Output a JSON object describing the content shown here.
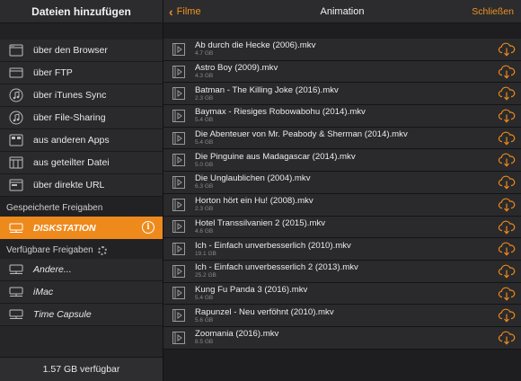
{
  "sidebar": {
    "header": "Dateien hinzufügen",
    "items": [
      {
        "label": "über den Browser",
        "icon": "browser-icon"
      },
      {
        "label": "über FTP",
        "icon": "ftp-icon"
      },
      {
        "label": "über iTunes Sync",
        "icon": "music-note-icon"
      },
      {
        "label": "über File-Sharing",
        "icon": "music-note-icon"
      },
      {
        "label": "aus anderen Apps",
        "icon": "apps-icon"
      },
      {
        "label": "aus geteilter Datei",
        "icon": "shared-file-icon"
      },
      {
        "label": "über direkte URL",
        "icon": "url-icon"
      }
    ],
    "saved_shares_label": "Gespeicherte Freigaben",
    "saved_shares": [
      {
        "label": "DISKSTATION",
        "icon": "nas-icon",
        "info": "i"
      }
    ],
    "available_shares_label": "Verfügbare Freigaben",
    "available_shares": [
      {
        "label": "Andere...",
        "icon": "nas-icon"
      },
      {
        "label": "iMac",
        "icon": "nas-icon"
      },
      {
        "label": "Time Capsule",
        "icon": "nas-icon"
      }
    ],
    "footer": "1.57 GB verfügbar"
  },
  "nav": {
    "back_label": "Filme",
    "title": "Animation",
    "close_label": "Schließen"
  },
  "files": [
    {
      "title": "Ab durch die Hecke (2006).mkv",
      "size": "4.7 GB"
    },
    {
      "title": "Astro Boy (2009).mkv",
      "size": "4.3 GB"
    },
    {
      "title": "Batman - The Killing Joke (2016).mkv",
      "size": "2.3 GB"
    },
    {
      "title": "Baymax - Riesiges Robowabohu (2014).mkv",
      "size": "5.4 GB"
    },
    {
      "title": "Die Abenteuer von Mr. Peabody & Sherman (2014).mkv",
      "size": "5.4 GB"
    },
    {
      "title": "Die Pinguine aus Madagascar (2014).mkv",
      "size": "5.0 GB"
    },
    {
      "title": "Die Unglaublichen (2004).mkv",
      "size": "6.3 GB"
    },
    {
      "title": "Horton hört ein Hu! (2008).mkv",
      "size": "2.3 GB"
    },
    {
      "title": "Hotel Transsilvanien 2 (2015).mkv",
      "size": "4.6 GB"
    },
    {
      "title": "Ich - Einfach unverbesserlich (2010).mkv",
      "size": "19.1 GB"
    },
    {
      "title": "Ich - Einfach unverbesserlich 2 (2013).mkv",
      "size": "25.2 GB"
    },
    {
      "title": "Kung Fu Panda 3 (2016).mkv",
      "size": "5.4 GB"
    },
    {
      "title": "Rapunzel - Neu verföhnt (2010).mkv",
      "size": "5.6 GB"
    },
    {
      "title": "Zoomania (2016).mkv",
      "size": "8.5 GB"
    }
  ],
  "colors": {
    "accent": "#ee8a1c",
    "background": "#1e1e20",
    "row": "#2a2a2c"
  }
}
